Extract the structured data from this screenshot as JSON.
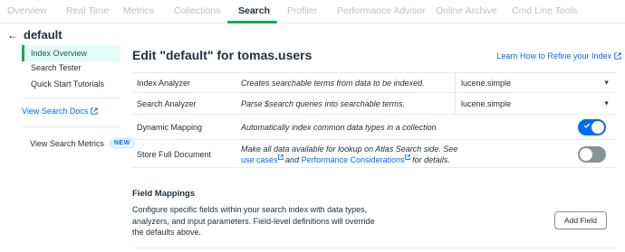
{
  "tabs": [
    {
      "label": "Overview",
      "active": false
    },
    {
      "label": "Real Time",
      "active": false
    },
    {
      "label": "Metrics",
      "active": false
    },
    {
      "label": "Collections",
      "active": false
    },
    {
      "label": "Search",
      "active": true
    },
    {
      "label": "Profiler",
      "active": false
    },
    {
      "label": "Performance Advisor",
      "active": false
    },
    {
      "label": "Online Archive",
      "active": false
    },
    {
      "label": "Cmd Line Tools",
      "active": false
    }
  ],
  "sidebar": {
    "back_icon": "arrow-left-icon",
    "index_name": "default",
    "items": [
      {
        "label": "Index Overview",
        "active": true
      },
      {
        "label": "Search Tester",
        "active": false
      },
      {
        "label": "Quick Start Tutorials",
        "active": false
      }
    ],
    "docs_link": "View Search Docs",
    "metrics_link": "View Search Metrics",
    "new_badge": "NEW"
  },
  "main": {
    "title": "Edit \"default\" for tomas.users",
    "learn_link": "Learn How to Refine your Index",
    "settings": {
      "index_analyzer": {
        "label": "Index Analyzer",
        "description": "Creates searchable terms from data to be indexed.",
        "value": "lucene.simple"
      },
      "search_analyzer": {
        "label": "Search Analyzer",
        "description": "Parse $search queries into searchable terms.",
        "value": "lucene.simple"
      },
      "dynamic_mapping": {
        "label": "Dynamic Mapping",
        "description": "Automatically index common data types in a collection",
        "enabled": true
      },
      "store_full_document": {
        "label": "Store Full Document",
        "description_line1": "Make all data available for lookup on Atlas Search side. See",
        "use_cases_link": "use cases",
        "and_text": "and",
        "perf_link": "Performance Considerations",
        "details_text": "for details.",
        "enabled": false
      }
    },
    "field_mappings": {
      "title": "Field Mappings",
      "description": "Configure specific fields within your search index with data types, analyzers, and input parameters. Field-level definitions will override the defaults above.",
      "add_button": "Add Field"
    }
  },
  "colors": {
    "accent_green": "#13aa52",
    "link_blue": "#016bf8",
    "toggle_on": "#016bf8",
    "toggle_off": "#889397"
  }
}
